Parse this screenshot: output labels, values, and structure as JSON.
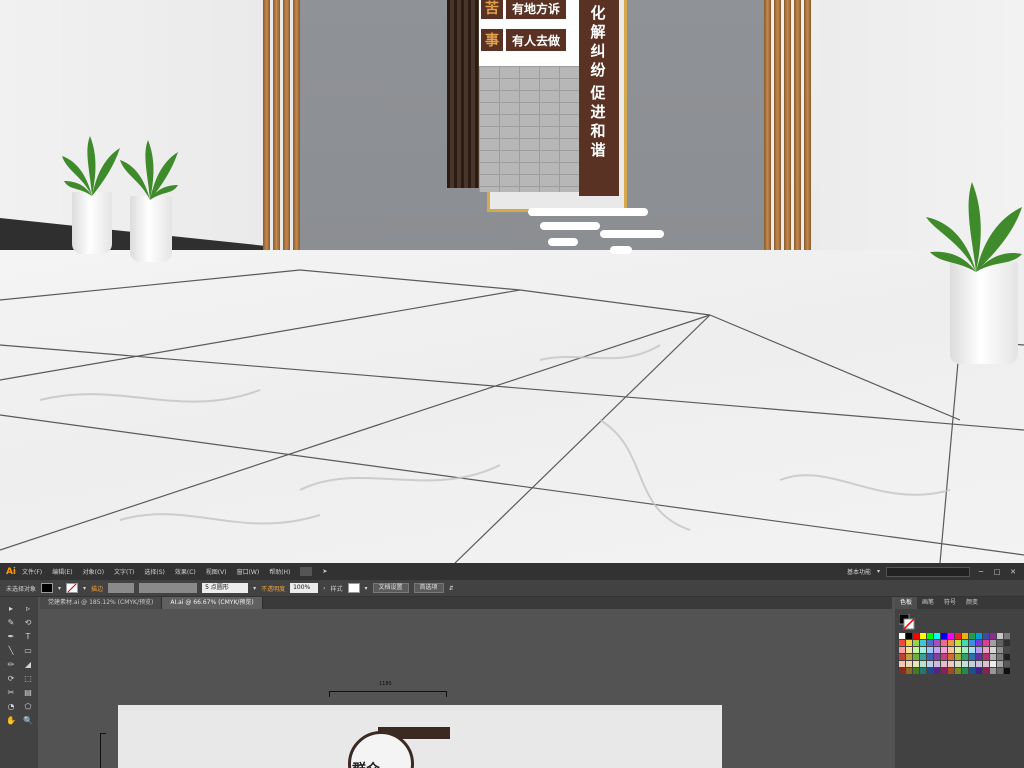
{
  "sign": {
    "rows": [
      {
        "badge": "苦",
        "label": "有地方诉"
      },
      {
        "badge": "事",
        "label": "有人去做"
      }
    ],
    "column_text": [
      "化",
      "解",
      "纠",
      "纷",
      "促",
      "进",
      "和",
      "谐"
    ]
  },
  "illustrator": {
    "app_logo": "Ai",
    "menu": [
      "文件(F)",
      "编辑(E)",
      "对象(O)",
      "文字(T)",
      "选择(S)",
      "效果(C)",
      "视图(V)",
      "窗口(W)",
      "帮助(H)"
    ],
    "workspace_label": "基本功能",
    "search_placeholder": "",
    "window_buttons": [
      "─",
      "□",
      "✕"
    ],
    "control_bar": {
      "selection_status": "未选择对象",
      "stroke_label": "描边",
      "stroke_value": "",
      "brush_value": "5 点圆形",
      "opacity_label": "不透明度",
      "opacity_value": "100%",
      "style_label": "样式",
      "doc_setup_button": "文档设置",
      "preferences_button": "首选项"
    },
    "tabs": [
      {
        "label": "党建素材.ai @ 185.12% (CMYK/预览)",
        "active": false
      },
      {
        "label": "AI.ai @ 66.67% (CMYK/预览)",
        "active": true
      }
    ],
    "tools": [
      "▸",
      "▹",
      "✎",
      "⟲",
      "✒",
      "T",
      "╲",
      "▭",
      "✏",
      "◢",
      "⟳",
      "⬚",
      "✂",
      "▤",
      "◔",
      "⬠",
      "✋",
      "🔍"
    ],
    "canvas": {
      "dimension_label": "1180",
      "artboard_logo_text": "群众"
    },
    "panel_tabs": [
      {
        "label": "色板",
        "active": true
      },
      {
        "label": "画笔",
        "active": false
      },
      {
        "label": "符号",
        "active": false
      },
      {
        "label": "颜变",
        "active": false
      }
    ],
    "swatch_colors": [
      "#ffffff",
      "#000000",
      "#ff0000",
      "#ffff00",
      "#00ff00",
      "#00ffff",
      "#0000ff",
      "#ff00ff",
      "#e8262a",
      "#f0b400",
      "#1ea04a",
      "#009fd8",
      "#3a4ea0",
      "#8b2d8f",
      "#c8c8c8",
      "#7a7a7a",
      "#f04a3a",
      "#f5d23a",
      "#9cd24a",
      "#3ac8e0",
      "#4a70d0",
      "#b04ac0",
      "#f06a8a",
      "#f09a3a",
      "#c8e03a",
      "#3ae0b0",
      "#3a90e0",
      "#7a3ae0",
      "#e03a9a",
      "#a0a0a0",
      "#606060",
      "#303030",
      "#f5a0a0",
      "#f5e0a0",
      "#c8f0a0",
      "#a0f0e0",
      "#a0c8f5",
      "#c8a0f5",
      "#f5a0d8",
      "#f5c8a0",
      "#e0f0a0",
      "#a0f0c0",
      "#a0e0f5",
      "#b0a0f5",
      "#f0a0c0",
      "#d8d8d8",
      "#909090",
      "#484848",
      "#c0403a",
      "#c0a03a",
      "#70b03a",
      "#3aa0a0",
      "#3a60b0",
      "#8040a0",
      "#c04080",
      "#d07030",
      "#a0b030",
      "#30a070",
      "#3070b0",
      "#6030a0",
      "#b03070",
      "#b4b4b4",
      "#787878",
      "#202020",
      "#f7c6b0",
      "#f0d8b0",
      "#e0e8b8",
      "#b8e0d0",
      "#b8d0e8",
      "#d0b8e0",
      "#e8b8d0",
      "#f0c8c0",
      "#d8e0c0",
      "#c0e0d8",
      "#c0d0e0",
      "#d0c0e0",
      "#e0c0d0",
      "#ececec",
      "#a8a8a8",
      "#585858",
      "#8a2a20",
      "#8a6a20",
      "#4a7a20",
      "#207a6a",
      "#204a8a",
      "#5a208a",
      "#8a205a",
      "#a05020",
      "#7a8a20",
      "#208a50",
      "#20508a",
      "#40208a",
      "#8a2050",
      "#989898",
      "#686868",
      "#101010"
    ]
  }
}
